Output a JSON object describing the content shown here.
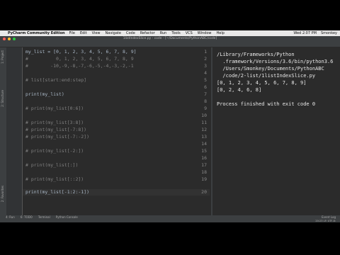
{
  "menubar": {
    "app": "PyCharm Community Edition",
    "items": [
      "File",
      "Edit",
      "View",
      "Navigate",
      "Code",
      "Refactor",
      "Run",
      "Tools",
      "VCS",
      "Window",
      "Help"
    ],
    "clock": "Wed 2:07 PM",
    "user": "Smonkey"
  },
  "titlebar": {
    "title": "1listIndexSlice.py - code - [~/Documents/PythonABC/code]"
  },
  "editor": {
    "line_numbers": [
      "1",
      "2",
      "3",
      "4",
      "5",
      "6",
      "7",
      "8",
      "9",
      "10",
      "11",
      "12",
      "13",
      "14",
      "15",
      "16",
      "17",
      "18",
      "19",
      "20"
    ],
    "lines": [
      "my_list = [0, 1, 2, 3, 4, 5, 6, 7, 8, 9]",
      "#          0, 1, 2, 3, 4, 5, 6, 7, 8, 9",
      "#        -10,-9,-8,-7,-6,-5,-4,-3,-2,-1",
      "",
      "# list[start:end:step]",
      "",
      "print(my_list)",
      "",
      "# print(my_list[0:6])",
      "",
      "# print(my_list[3:8])",
      "# print(my_list[-7:8])",
      "# print(my_list[-7:-2])",
      "",
      "# print(my_list[-2:])",
      "",
      "# print(my_list[:])",
      "",
      "# print(my_list[::2])",
      "print(my_list[-1:2:-1])"
    ]
  },
  "run": {
    "output": [
      "/Library/Frameworks/Python",
      "  .framework/Versions/3.6/bin/python3.6",
      "  /Users/Smonkey/Documents/PythonABC",
      "  /code/2-list/1listIndexSlice.py",
      "[0, 1, 2, 3, 4, 5, 6, 7, 8, 9]",
      "[0, 2, 4, 6, 8]",
      "",
      "Process finished with exit code 0"
    ]
  },
  "bottombar": {
    "tabs": [
      "4: Run",
      "6: TODO",
      "Terminal",
      "Python Console"
    ],
    "event_log": "Event Log"
  },
  "statusbar": {
    "text": "20:23  LF:  UTF-8:"
  },
  "lefttabs": [
    "1: Project",
    "2: Structure",
    "2: Favorites"
  ]
}
